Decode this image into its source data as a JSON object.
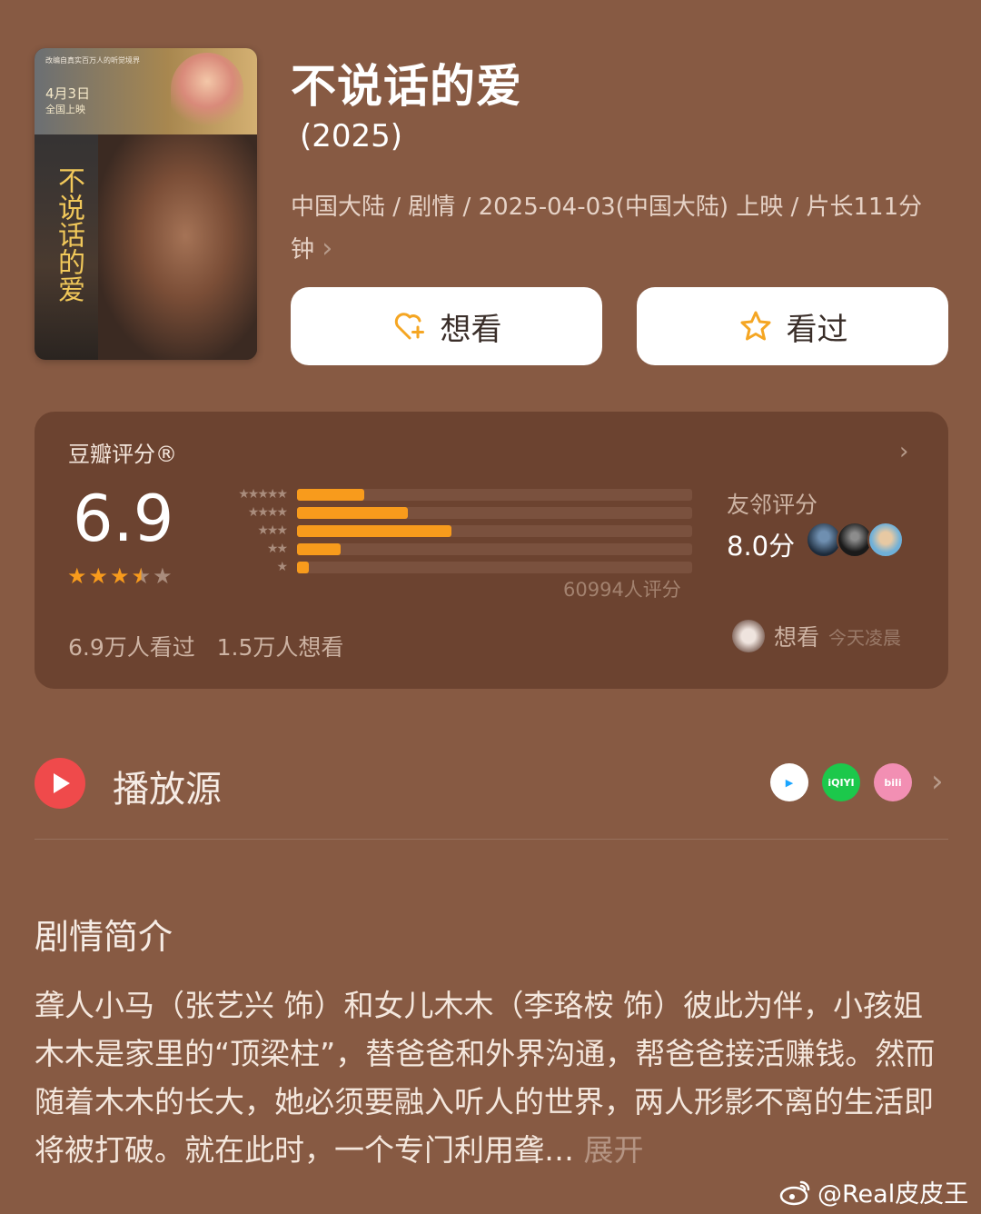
{
  "movie": {
    "poster_tagline": "改编自真实百万人的听觉境界",
    "poster_date": "4月3日",
    "poster_release": "全国上映",
    "poster_title": "不说话的爱",
    "title": "不说话的爱",
    "year": "(2025)",
    "meta": "中国大陆 / 剧情 / 2025-04-03(中国大陆) 上映 / 片长111分钟",
    "meta_chevron": "›"
  },
  "actions": {
    "want_label": "想看",
    "watched_label": "看过"
  },
  "rating": {
    "label": "豆瓣评分®",
    "chevron": "›",
    "score": "6.9",
    "stars": 3.5,
    "distribution": [
      {
        "stars": "★★★★★",
        "fraction": 0.17
      },
      {
        "stars": "★★★★",
        "fraction": 0.28
      },
      {
        "stars": "★★★",
        "fraction": 0.39
      },
      {
        "stars": "★★",
        "fraction": 0.11
      },
      {
        "stars": "★",
        "fraction": 0.03
      }
    ],
    "count": "60994人评分",
    "friend_label": "友邻评分",
    "friend_score": "8.0分",
    "watched_count": "6.9万人看过",
    "want_count": "1.5万人想看",
    "recent_action": "想看",
    "recent_time": "今天凌晨"
  },
  "sources": {
    "title": "播放源",
    "items": [
      {
        "name": "tencent-video",
        "label": "▶",
        "color": "#ffffff"
      },
      {
        "name": "iqiyi",
        "label": "iQIYI",
        "color": "#1cc84b"
      },
      {
        "name": "bilibili",
        "label": "bili",
        "color": "#f28fb3"
      }
    ],
    "chevron": "›"
  },
  "synopsis": {
    "title": "剧情简介",
    "text": "聋人小马（张艺兴 饰）和女儿木木（李珞桉 饰）彼此为伴，小孩姐木木是家里的“顶梁柱”，替爸爸和外界沟通，帮爸爸接活赚钱。然而随着木木的长大，她必须要融入听人的世界，两人形影不离的生活即将被打破。就在此时，一个专门利用聋…",
    "more": "展开"
  },
  "watermark": "@Real皮皮王"
}
